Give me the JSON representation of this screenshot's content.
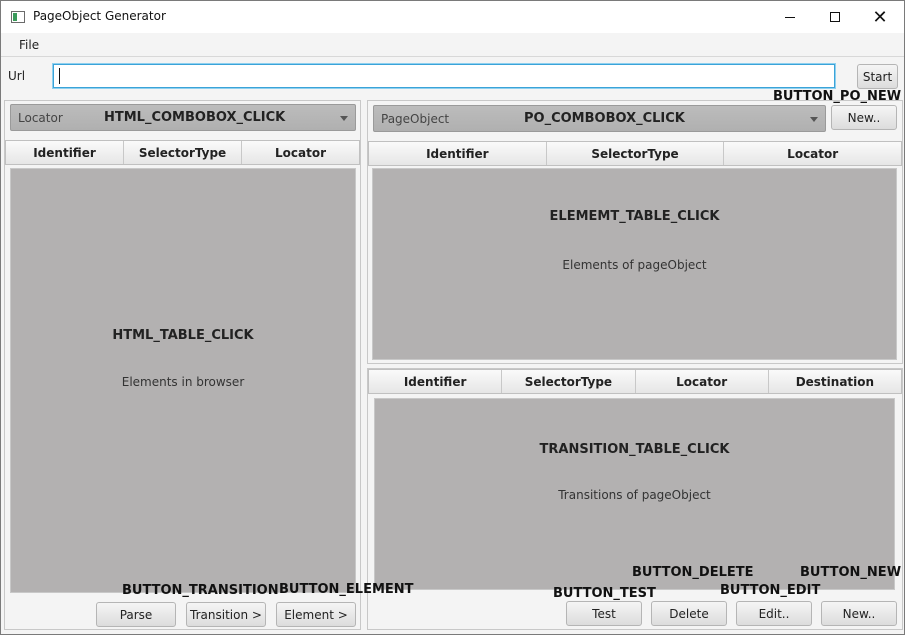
{
  "window": {
    "title": "PageObject Generator",
    "minimize_glyph": "",
    "maximize_glyph": "",
    "close_glyph": "✕"
  },
  "menu": {
    "file": "File"
  },
  "url": {
    "label": "Url",
    "value": "",
    "start_label": "Start"
  },
  "left": {
    "combo_label": "Locator",
    "combo_value": "HTML_COMBOBOX_CLICK",
    "columns": [
      "Identifier",
      "SelectorType",
      "Locator"
    ],
    "table_title": "HTML_TABLE_CLICK",
    "table_placeholder": "Elements in browser",
    "buttons": {
      "parse": "Parse",
      "transition": "Transition >",
      "element": "Element >"
    }
  },
  "right_top": {
    "combo_label": "PageObject",
    "combo_value": "PO_COMBOBOX_CLICK",
    "new_label": "New..",
    "columns": [
      "Identifier",
      "SelectorType",
      "Locator"
    ],
    "table_title": "ELEMEMT_TABLE_CLICK",
    "table_placeholder": "Elements of pageObject"
  },
  "right_bottom": {
    "columns": [
      "Identifier",
      "SelectorType",
      "Locator",
      "Destination"
    ],
    "table_title": "TRANSITION_TABLE_CLICK",
    "table_placeholder": "Transitions of pageObject",
    "buttons": {
      "test": "Test",
      "delete": "Delete",
      "edit": "Edit..",
      "new": "New.."
    }
  },
  "annotations": {
    "po_new": "BUTTON_PO_NEW",
    "transition": "BUTTON_TRANSITION",
    "element": "BUTTON_ELEMENT",
    "test": "BUTTON_TEST",
    "delete": "BUTTON_DELETE",
    "edit": "BUTTON_EDIT",
    "new": "BUTTON_NEW"
  }
}
